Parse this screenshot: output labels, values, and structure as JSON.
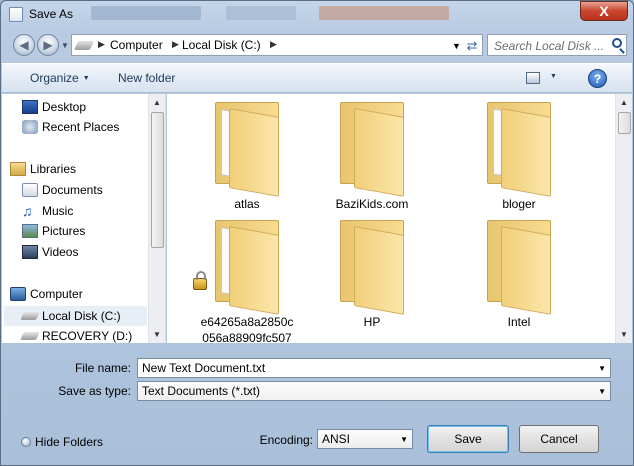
{
  "window": {
    "title": "Save As",
    "close_glyph": "X"
  },
  "address_bar": {
    "crumbs": [
      "Computer",
      "Local Disk (C:)"
    ],
    "search_placeholder": "Search Local Disk ..."
  },
  "toolbar": {
    "organize_label": "Organize",
    "new_folder_label": "New folder",
    "help_glyph": "?"
  },
  "nav_pane": {
    "items": [
      {
        "label": "Desktop",
        "icon": "desktop-icon"
      },
      {
        "label": "Recent Places",
        "icon": "recent-places-icon"
      },
      {
        "label": "Libraries",
        "icon": "libraries-icon"
      },
      {
        "label": "Documents",
        "icon": "documents-icon"
      },
      {
        "label": "Music",
        "icon": "music-icon"
      },
      {
        "label": "Pictures",
        "icon": "pictures-icon"
      },
      {
        "label": "Videos",
        "icon": "videos-icon"
      },
      {
        "label": "Computer",
        "icon": "computer-icon"
      },
      {
        "label": "Local Disk (C:)",
        "icon": "drive-icon",
        "selected": true
      },
      {
        "label": "RECOVERY (D:)",
        "icon": "drive-icon"
      }
    ]
  },
  "files": [
    {
      "name": "atlas",
      "icon": "folder-icon"
    },
    {
      "name": "BaziKids.com",
      "icon": "folder-icon"
    },
    {
      "name": "bloger",
      "icon": "folder-icon"
    },
    {
      "name_line1": "e64265a8a2850c",
      "name_line2": "056a88909fc507",
      "icon": "locked-folder-icon"
    },
    {
      "name": "HP",
      "icon": "folder-icon"
    },
    {
      "name": "Intel",
      "icon": "folder-icon"
    }
  ],
  "form": {
    "file_name_label": "File name:",
    "file_name_value": "New Text Document.txt",
    "save_as_type_label": "Save as type:",
    "save_as_type_value": "Text Documents (*.txt)",
    "encoding_label": "Encoding:",
    "encoding_value": "ANSI"
  },
  "footer": {
    "hide_folders_label": "Hide Folders",
    "save_label": "Save",
    "cancel_label": "Cancel"
  },
  "colors": {
    "close_button": "#c9452e",
    "toolbar_text": "#1e395b"
  }
}
